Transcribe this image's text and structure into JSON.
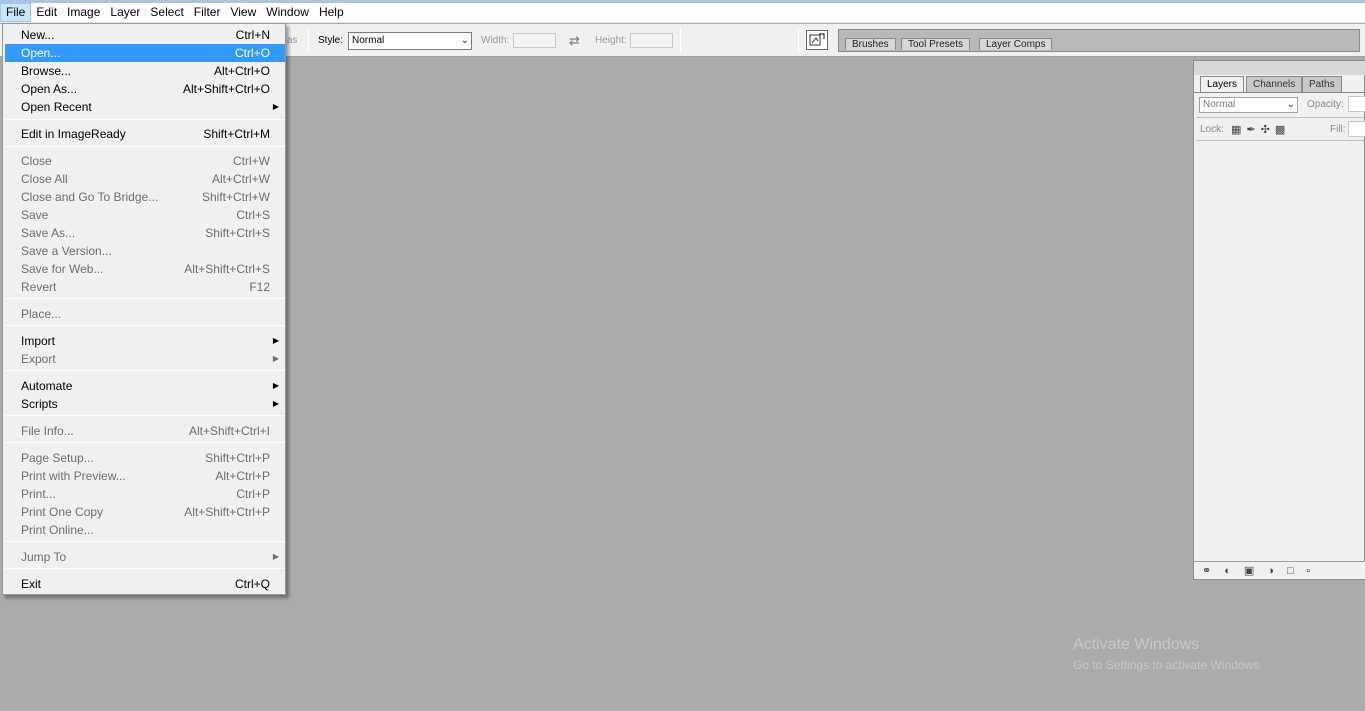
{
  "menubar": {
    "items": [
      "File",
      "Edit",
      "Image",
      "Layer",
      "Select",
      "Filter",
      "View",
      "Window",
      "Help"
    ]
  },
  "options": {
    "partial_label": "as",
    "style_label": "Style:",
    "style_value": "Normal",
    "width_label": "Width:",
    "height_label": "Height:"
  },
  "well": {
    "tabs": [
      "Brushes",
      "Tool Presets",
      "Layer Comps"
    ]
  },
  "file_menu": {
    "items": [
      {
        "label": "New...",
        "shortcut": "Ctrl+N"
      },
      {
        "label": "Open...",
        "shortcut": "Ctrl+O"
      },
      {
        "label": "Browse...",
        "shortcut": "Alt+Ctrl+O"
      },
      {
        "label": "Open As...",
        "shortcut": "Alt+Shift+Ctrl+O"
      },
      {
        "label": "Open Recent",
        "shortcut": ""
      },
      {
        "label": "Edit in ImageReady",
        "shortcut": "Shift+Ctrl+M"
      },
      {
        "label": "Close",
        "shortcut": "Ctrl+W"
      },
      {
        "label": "Close All",
        "shortcut": "Alt+Ctrl+W"
      },
      {
        "label": "Close and Go To Bridge...",
        "shortcut": "Shift+Ctrl+W"
      },
      {
        "label": "Save",
        "shortcut": "Ctrl+S"
      },
      {
        "label": "Save As...",
        "shortcut": "Shift+Ctrl+S"
      },
      {
        "label": "Save a Version...",
        "shortcut": ""
      },
      {
        "label": "Save for Web...",
        "shortcut": "Alt+Shift+Ctrl+S"
      },
      {
        "label": "Revert",
        "shortcut": "F12"
      },
      {
        "label": "Place...",
        "shortcut": ""
      },
      {
        "label": "Import",
        "shortcut": ""
      },
      {
        "label": "Export",
        "shortcut": ""
      },
      {
        "label": "Automate",
        "shortcut": ""
      },
      {
        "label": "Scripts",
        "shortcut": ""
      },
      {
        "label": "File Info...",
        "shortcut": "Alt+Shift+Ctrl+I"
      },
      {
        "label": "Page Setup...",
        "shortcut": "Shift+Ctrl+P"
      },
      {
        "label": "Print with Preview...",
        "shortcut": "Alt+Ctrl+P"
      },
      {
        "label": "Print...",
        "shortcut": "Ctrl+P"
      },
      {
        "label": "Print One Copy",
        "shortcut": "Alt+Shift+Ctrl+P"
      },
      {
        "label": "Print Online...",
        "shortcut": ""
      },
      {
        "label": "Jump To",
        "shortcut": ""
      },
      {
        "label": "Exit",
        "shortcut": "Ctrl+Q"
      }
    ]
  },
  "layers_panel": {
    "tabs": [
      "Layers",
      "Channels",
      "Paths"
    ],
    "blend_mode": "Normal",
    "opacity_label": "Opacity:",
    "lock_label": "Lock:",
    "fill_label": "Fill:"
  },
  "watermark": {
    "title": "Activate Windows",
    "subtitle": "Go to Settings to activate Windows."
  }
}
